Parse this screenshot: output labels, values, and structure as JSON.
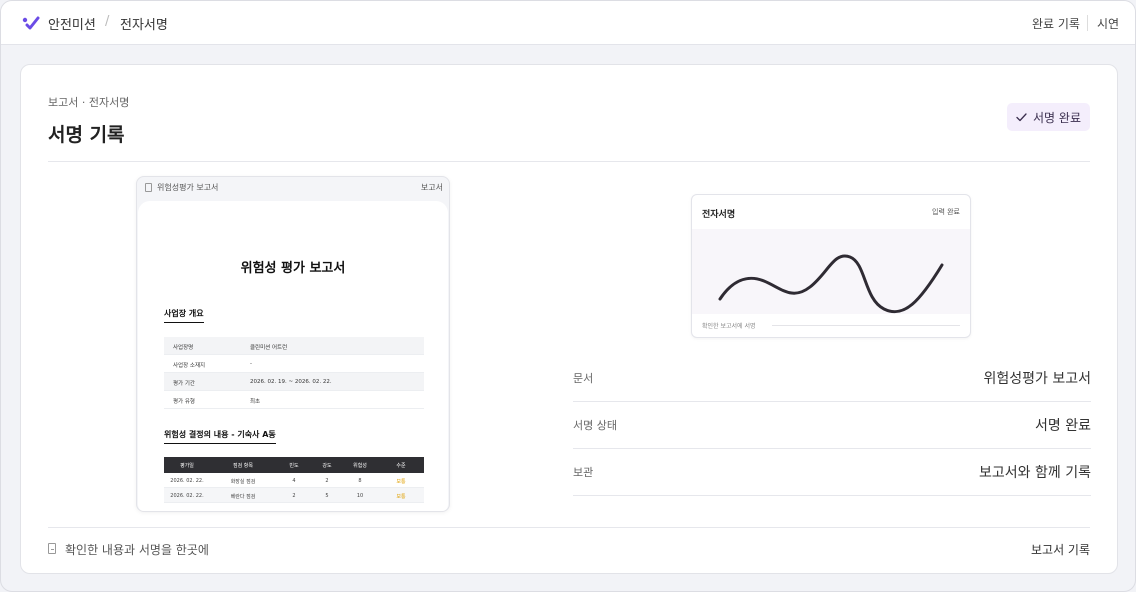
{
  "topbar": {
    "app_name": "안전미션",
    "separator": "/",
    "page_name": "전자서명",
    "nav_history": "완료 기록",
    "nav_demo": "시연",
    "accent": "#6b4ce6"
  },
  "card": {
    "breadcrumb": "보고서 · 전자서명",
    "title": "서명 기록",
    "badge": "서명 완료",
    "badge_icon": "check-icon"
  },
  "document": {
    "header_title": "위험성평가 보고서",
    "header_right": "보고서",
    "title": "위험성 평가 보고서",
    "section_overview": "사업장 개요",
    "overview_rows": [
      {
        "key": "사업장명",
        "value": "클린미션 어트런"
      },
      {
        "key": "사업장 소재지",
        "value": "-"
      },
      {
        "key": "평가 기간",
        "value": "2026. 02. 19. ~ 2026. 02. 22."
      },
      {
        "key": "평가 유형",
        "value": "최초"
      }
    ],
    "section_risk": "위험성 결정의 내용 - 기숙사 A동",
    "risk_columns": [
      "평가일",
      "점검 항목",
      "빈도",
      "강도",
      "위험성",
      "수준"
    ],
    "risk_rows": [
      [
        "2026. 02. 22.",
        "화장실 점검",
        "4",
        "2",
        "8",
        "보통"
      ],
      [
        "2026. 02. 22.",
        "베란다 점검",
        "2",
        "5",
        "10",
        "보통"
      ]
    ]
  },
  "signature": {
    "title": "전자서명",
    "status": "입력 완료",
    "caption": "확인한 보고서에 서명"
  },
  "details": [
    {
      "key": "문서",
      "value": "위험성평가 보고서"
    },
    {
      "key": "서명 상태",
      "value": "서명 완료"
    },
    {
      "key": "보관",
      "value": "보고서와 함께 기록"
    }
  ],
  "footer": {
    "text": "확인한 내용과 서명을 한곳에",
    "link": "보고서 기록"
  }
}
